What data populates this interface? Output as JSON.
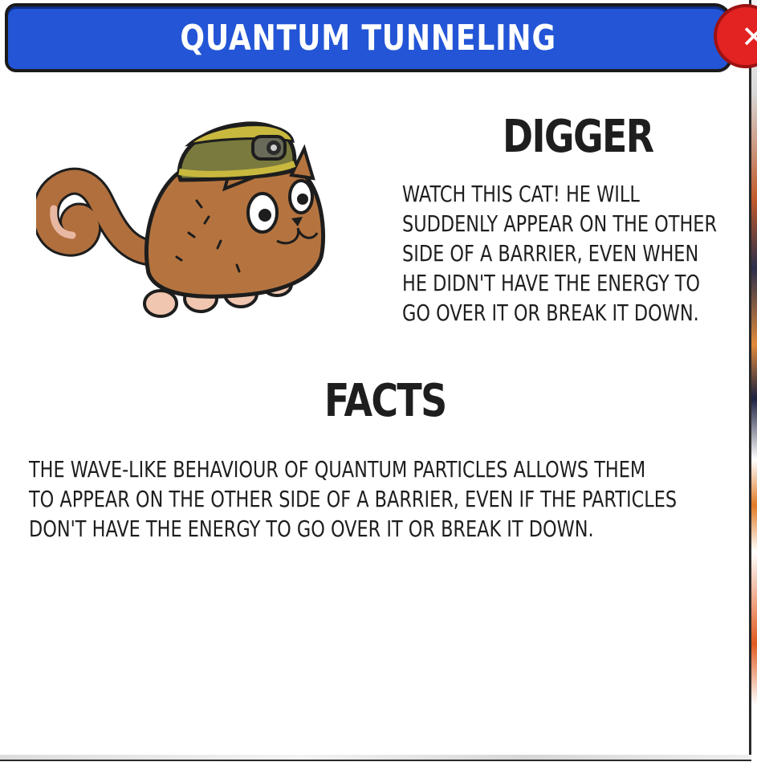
{
  "dialog": {
    "title": "QUANTUM TUNNELING",
    "close_icon": "close-icon",
    "close_label": "✕",
    "accent_color": "#2355d6",
    "close_color": "#e32222"
  },
  "card": {
    "character_art": "digger-cat-illustration",
    "name_heading": "DIGGER",
    "description_lines": [
      "WATCH THIS CAT! HE WILL",
      "SUDDENLY APPEAR ON THE OTHER",
      "SIDE OF A BARRIER, EVEN WHEN",
      "HE DIDN'T HAVE THE ENERGY TO",
      "GO OVER IT OR BREAK IT DOWN."
    ]
  },
  "facts": {
    "heading": "FACTS",
    "lines": [
      "THE WAVE-LIKE BEHAVIOUR OF QUANTUM PARTICLES ALLOWS THEM",
      "TO APPEAR ON THE OTHER SIDE OF A BARRIER, EVEN IF THE PARTICLES",
      "DON'T HAVE THE ENERGY TO GO OVER IT OR BREAK IT DOWN."
    ]
  }
}
